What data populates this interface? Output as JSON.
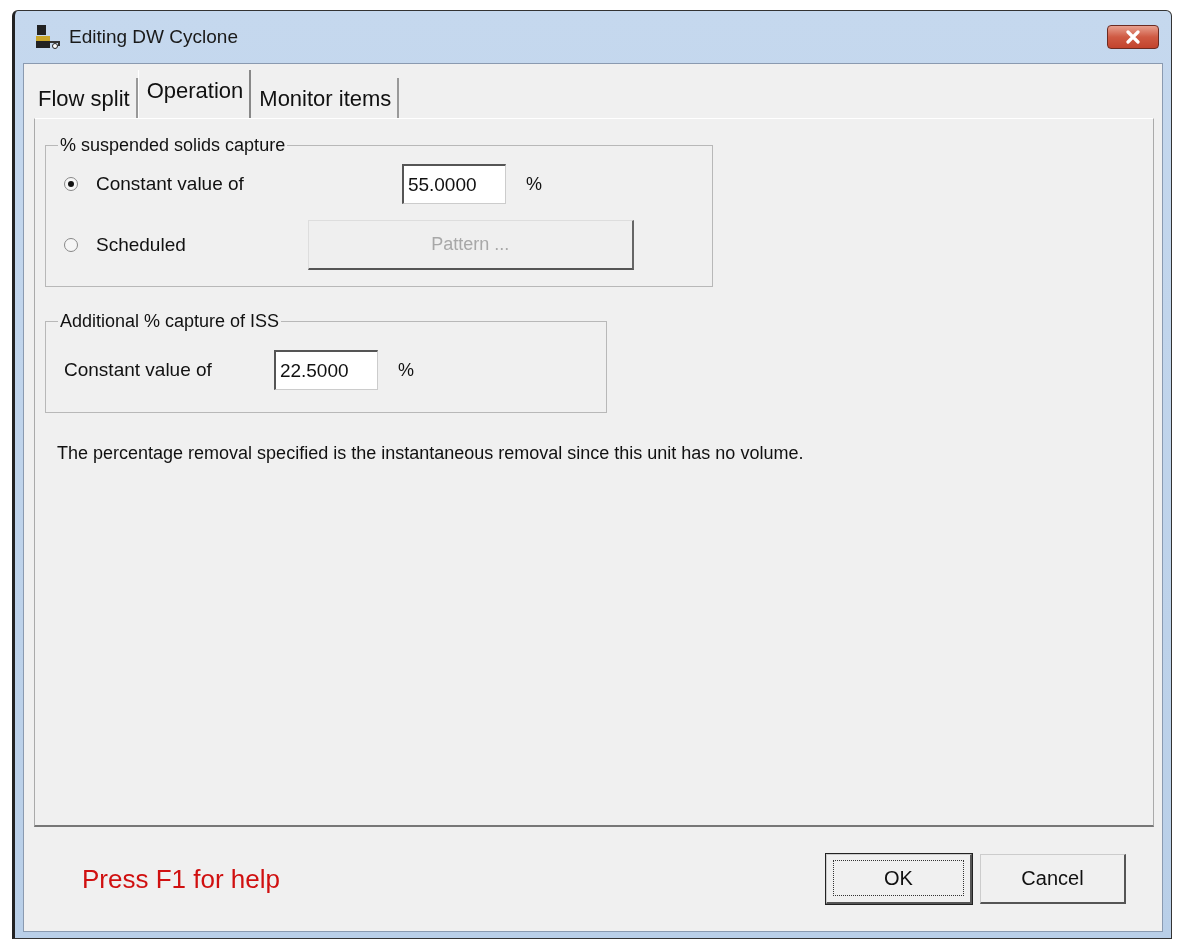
{
  "window": {
    "title": "Editing DW Cyclone"
  },
  "tabs": [
    {
      "label": "Flow split",
      "selected": false
    },
    {
      "label": "Operation",
      "selected": true
    },
    {
      "label": "Monitor items",
      "selected": false
    }
  ],
  "solids_group": {
    "title": "% suspended solids capture",
    "options": [
      {
        "label": "Constant value of",
        "selected": true
      },
      {
        "label": "Scheduled",
        "selected": false
      }
    ],
    "value": "55.0000",
    "unit": "%",
    "pattern_button": {
      "label": "Pattern ...",
      "disabled": true
    }
  },
  "iss_group": {
    "title": "Additional % capture of ISS",
    "label": "Constant value of",
    "value": "22.5000",
    "unit": "%"
  },
  "note": "The percentage removal specified is the instantaneous removal since this unit has no volume.",
  "help": "Press F1 for help",
  "buttons": [
    {
      "label": "OK",
      "default": true
    },
    {
      "label": "Cancel",
      "default": false
    }
  ]
}
